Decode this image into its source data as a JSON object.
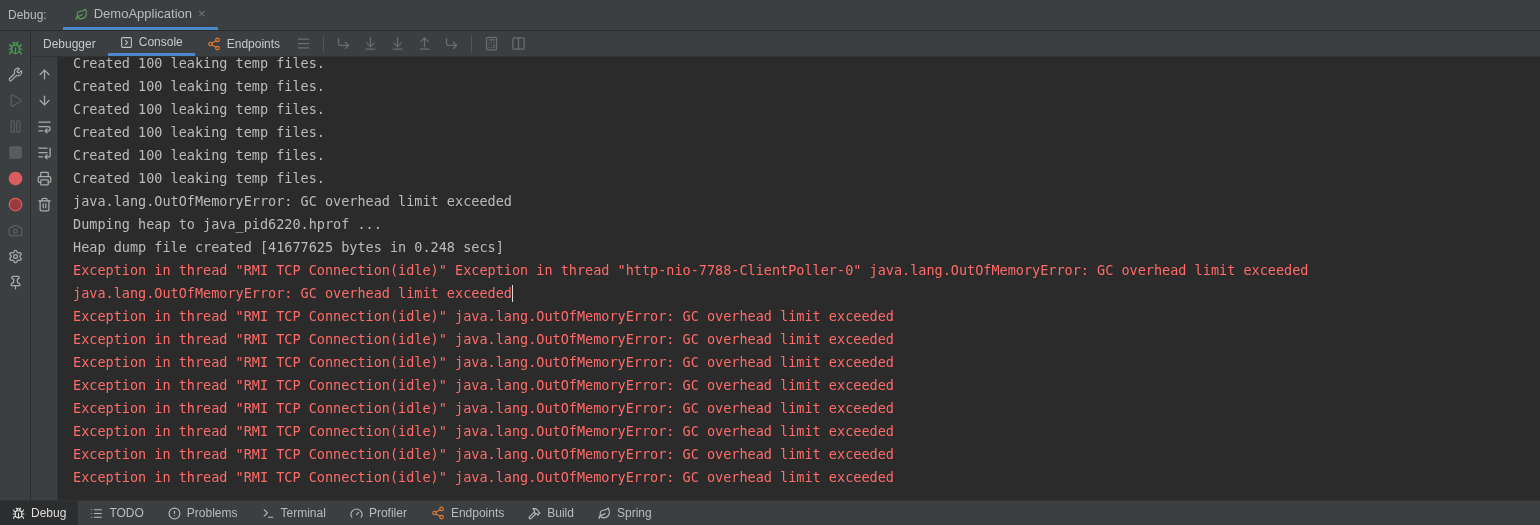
{
  "header": {
    "label": "Debug:",
    "tabs": [
      {
        "label": "DemoApplication",
        "close": "×",
        "selected": true
      }
    ]
  },
  "toolbar": {
    "tabs": [
      {
        "label": "Debugger",
        "selected": false
      },
      {
        "label": "Console",
        "selected": true
      },
      {
        "label": "Endpoints",
        "selected": false
      }
    ]
  },
  "console": {
    "lines": [
      {
        "text": "Created 100 leaking temp files.",
        "kind": "out",
        "cursor": false
      },
      {
        "text": "Created 100 leaking temp files.",
        "kind": "out",
        "cursor": false
      },
      {
        "text": "Created 100 leaking temp files.",
        "kind": "out",
        "cursor": false
      },
      {
        "text": "Created 100 leaking temp files.",
        "kind": "out",
        "cursor": false
      },
      {
        "text": "Created 100 leaking temp files.",
        "kind": "out",
        "cursor": false
      },
      {
        "text": "Created 100 leaking temp files.",
        "kind": "out",
        "cursor": false
      },
      {
        "text": "java.lang.OutOfMemoryError: GC overhead limit exceeded",
        "kind": "out",
        "cursor": false
      },
      {
        "text": "Dumping heap to java_pid6220.hprof ...",
        "kind": "out",
        "cursor": false
      },
      {
        "text": "Heap dump file created [41677625 bytes in 0.248 secs]",
        "kind": "out",
        "cursor": false
      },
      {
        "text": "Exception in thread \"RMI TCP Connection(idle)\" Exception in thread \"http-nio-7788-ClientPoller-0\" java.lang.OutOfMemoryError: GC overhead limit exceeded",
        "kind": "err",
        "cursor": false
      },
      {
        "text": "java.lang.OutOfMemoryError: GC overhead limit exceeded",
        "kind": "err",
        "cursor": true
      },
      {
        "text": "Exception in thread \"RMI TCP Connection(idle)\" java.lang.OutOfMemoryError: GC overhead limit exceeded",
        "kind": "err",
        "cursor": false
      },
      {
        "text": "Exception in thread \"RMI TCP Connection(idle)\" java.lang.OutOfMemoryError: GC overhead limit exceeded",
        "kind": "err",
        "cursor": false
      },
      {
        "text": "Exception in thread \"RMI TCP Connection(idle)\" java.lang.OutOfMemoryError: GC overhead limit exceeded",
        "kind": "err",
        "cursor": false
      },
      {
        "text": "Exception in thread \"RMI TCP Connection(idle)\" java.lang.OutOfMemoryError: GC overhead limit exceeded",
        "kind": "err",
        "cursor": false
      },
      {
        "text": "Exception in thread \"RMI TCP Connection(idle)\" java.lang.OutOfMemoryError: GC overhead limit exceeded",
        "kind": "err",
        "cursor": false
      },
      {
        "text": "Exception in thread \"RMI TCP Connection(idle)\" java.lang.OutOfMemoryError: GC overhead limit exceeded",
        "kind": "err",
        "cursor": false
      },
      {
        "text": "Exception in thread \"RMI TCP Connection(idle)\" java.lang.OutOfMemoryError: GC overhead limit exceeded",
        "kind": "err",
        "cursor": false
      },
      {
        "text": "Exception in thread \"RMI TCP Connection(idle)\" java.lang.OutOfMemoryError: GC overhead limit exceeded",
        "kind": "err",
        "cursor": false
      }
    ]
  },
  "bottom_tabs": [
    {
      "label": "Debug",
      "selected": true
    },
    {
      "label": "TODO",
      "selected": false
    },
    {
      "label": "Problems",
      "selected": false
    },
    {
      "label": "Terminal",
      "selected": false
    },
    {
      "label": "Profiler",
      "selected": false
    },
    {
      "label": "Endpoints",
      "selected": false
    },
    {
      "label": "Build",
      "selected": false
    },
    {
      "label": "Spring",
      "selected": false
    }
  ]
}
